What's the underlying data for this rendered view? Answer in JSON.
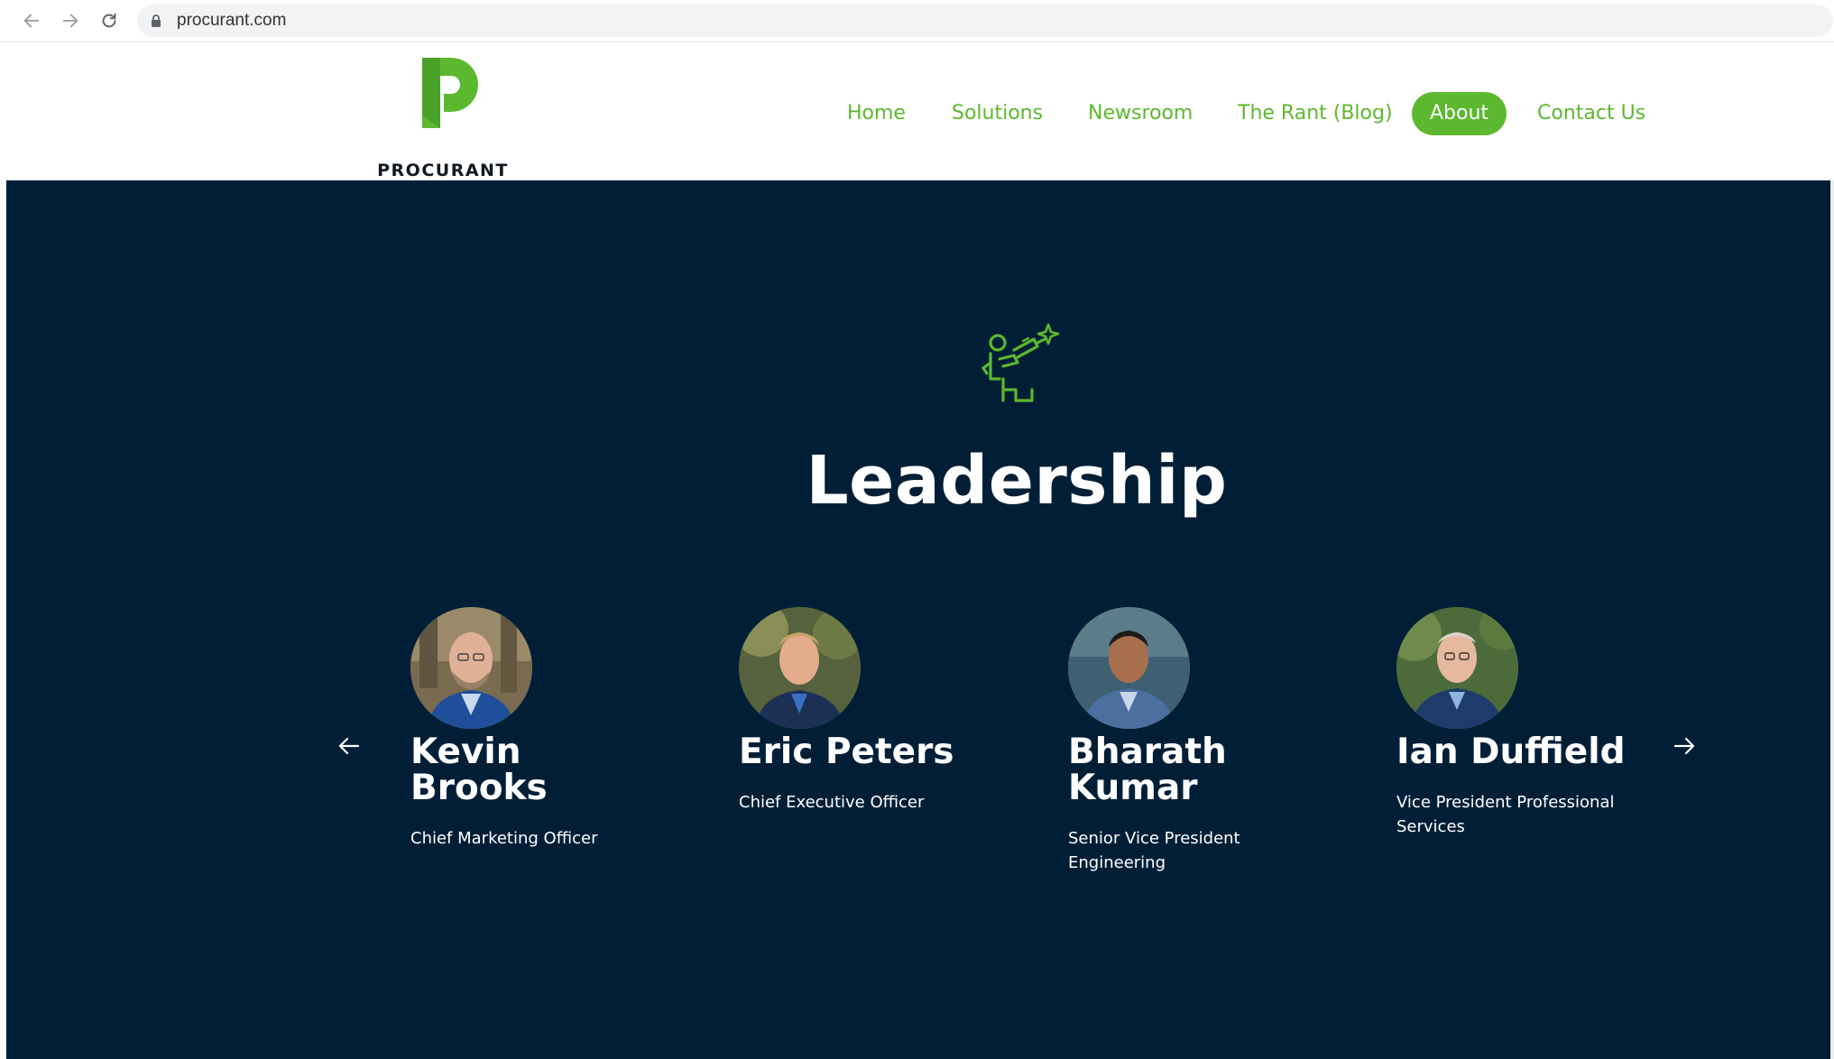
{
  "browser": {
    "url": "procurant.com"
  },
  "brand": {
    "name": "PROCURANT",
    "accent_color": "#5cb82e",
    "dark_color": "#001f36"
  },
  "nav": {
    "items": [
      {
        "label": "Home",
        "active": false
      },
      {
        "label": "Solutions",
        "active": false
      },
      {
        "label": "Newsroom",
        "active": false
      },
      {
        "label": "The Rant (Blog)",
        "active": false
      },
      {
        "label": "About",
        "active": true
      },
      {
        "label": "Contact Us",
        "active": false
      }
    ]
  },
  "leadership": {
    "title": "Leadership",
    "icon": "telescope-person-icon",
    "people": [
      {
        "name": "Kevin Brooks",
        "role": "Chief Marketing Officer"
      },
      {
        "name": "Eric Peters",
        "role": "Chief Executive Officer"
      },
      {
        "name": "Bharath Kumar",
        "role": "Senior Vice President Engineering"
      },
      {
        "name": "Ian Duffield",
        "role": "Vice President Professional Services"
      }
    ],
    "prev_icon": "arrow-left-icon",
    "next_icon": "arrow-right-icon"
  }
}
